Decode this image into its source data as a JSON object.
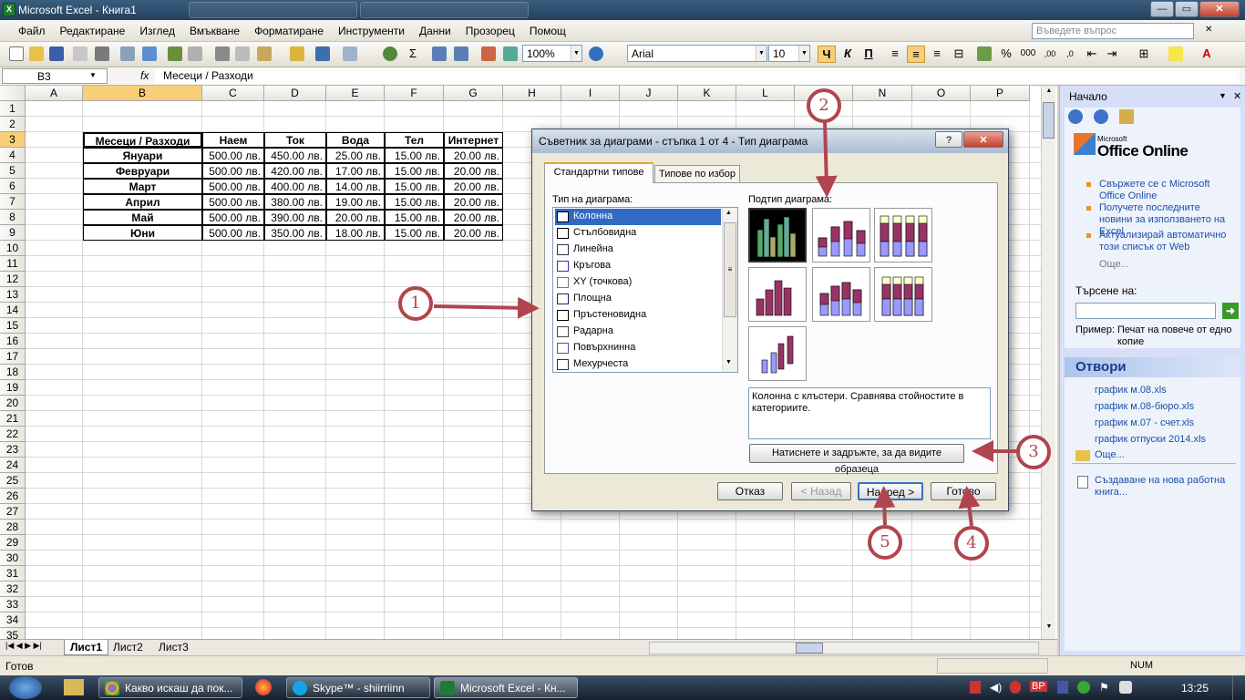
{
  "app": {
    "window_title": "Microsoft Excel - Книга1",
    "help_placeholder": "Въведете въпрос"
  },
  "menu": [
    "Файл",
    "Редактиране",
    "Изглед",
    "Вмъкване",
    "Форматиране",
    "Инструменти",
    "Данни",
    "Прозорец",
    "Помощ"
  ],
  "toolbar": {
    "zoom": "100%",
    "font": "Arial",
    "size": "10",
    "bold": "Ч",
    "italic": "К",
    "underline": "П"
  },
  "formula_bar": {
    "name_box": "B3",
    "fx": "fx",
    "content": "Месеци / Разходи"
  },
  "columns": [
    "A",
    "B",
    "C",
    "D",
    "E",
    "F",
    "G",
    "H",
    "I",
    "J",
    "K",
    "L",
    "M",
    "N",
    "O",
    "P"
  ],
  "rows": [
    "1",
    "2",
    "3",
    "4",
    "5",
    "6",
    "7",
    "8",
    "9",
    "10",
    "11",
    "12",
    "13",
    "14",
    "15",
    "16",
    "17",
    "18",
    "19",
    "20",
    "21",
    "22",
    "23",
    "24",
    "25",
    "26",
    "27",
    "28",
    "29",
    "30",
    "31",
    "32",
    "33",
    "34",
    "35"
  ],
  "table": {
    "headers": [
      "Месеци / Разходи",
      "Наем",
      "Ток",
      "Вода",
      "Тел",
      "Интернет"
    ],
    "rows": [
      [
        "Януари",
        "500.00 лв.",
        "450.00 лв.",
        "25.00 лв.",
        "15.00 лв.",
        "20.00 лв."
      ],
      [
        "Февруари",
        "500.00 лв.",
        "420.00 лв.",
        "17.00 лв.",
        "15.00 лв.",
        "20.00 лв."
      ],
      [
        "Март",
        "500.00 лв.",
        "400.00 лв.",
        "14.00 лв.",
        "15.00 лв.",
        "20.00 лв."
      ],
      [
        "Април",
        "500.00 лв.",
        "380.00 лв.",
        "19.00 лв.",
        "15.00 лв.",
        "20.00 лв."
      ],
      [
        "Май",
        "500.00 лв.",
        "390.00 лв.",
        "20.00 лв.",
        "15.00 лв.",
        "20.00 лв."
      ],
      [
        "Юни",
        "500.00 лв.",
        "350.00 лв.",
        "18.00 лв.",
        "15.00 лв.",
        "20.00 лв."
      ]
    ]
  },
  "sheets": [
    "Лист1",
    "Лист2",
    "Лист3"
  ],
  "status": {
    "left": "Готов",
    "num": "NUM"
  },
  "dialog": {
    "title": "Съветник за диаграми - стъпка 1 от 4 - Тип диаграма",
    "help": "?",
    "close": "✕",
    "tab_standard": "Стандартни типове",
    "tab_custom": "Типове по избор",
    "type_label": "Тип на диаграма:",
    "subtype_label": "Подтип диаграма:",
    "types": [
      "Колонна",
      "Стълбовидна",
      "Линейна",
      "Кръгова",
      "XY (точкова)",
      "Площна",
      "Пръстеновидна",
      "Радарна",
      "Повърхнинна",
      "Мехурчеста"
    ],
    "description": "Колонна с клъстери. Сравнява стойностите в категориите.",
    "preview_button": "Натиснете и задръжте, за да видите образеца",
    "cancel": "Отказ",
    "back": "< Назад",
    "next": "Напред >",
    "finish": "Готово"
  },
  "task_pane": {
    "title": "Начало",
    "logo_small": "Microsoft",
    "logo": "Office Online",
    "links": [
      "Свържете се с Microsoft Office Online",
      "Получете последните новини за използването на Excel",
      "Актуализирай автоматично този списък от Web"
    ],
    "more": "Още...",
    "search_label": "Търсене на:",
    "example_label": "Пример:",
    "example_text": "Печат на повече от едно копие",
    "open_title": "Отвори",
    "files": [
      "график м.08.xls",
      "график м.08-бюро.xls",
      "график м.07 - счет.xls",
      "график отпуски 2014.xls"
    ],
    "more2": "Още...",
    "new_workbook": "Създаване на нова работна книга..."
  },
  "taskbar": {
    "tasks": [
      "Какво искаш да пок...",
      "Skype™ - shiirriinn",
      "Microsoft Excel - Кн..."
    ],
    "lang": "BP",
    "time": "13:25"
  },
  "callouts": [
    "1",
    "2",
    "3",
    "4",
    "5"
  ],
  "colors": {
    "accent": "#b0454f",
    "selection": "#316ac5",
    "bar_blue": "#9999ff",
    "bar_maroon": "#993366",
    "bar_yellow": "#ffffcc"
  }
}
